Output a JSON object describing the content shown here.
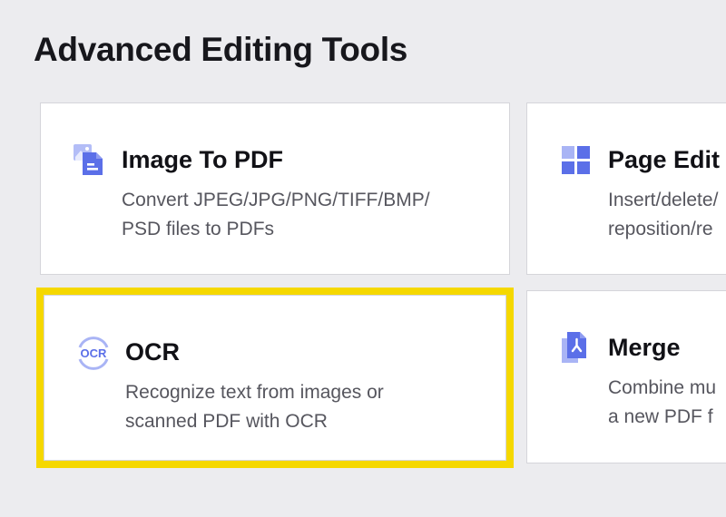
{
  "section": {
    "title": "Advanced Editing Tools"
  },
  "tools": [
    {
      "title": "Image To PDF",
      "desc_lines": [
        "Convert JPEG/JPG/PNG/TIFF/BMP/",
        "PSD files to PDFs"
      ],
      "icon": "image-to-pdf-icon",
      "highlighted": false
    },
    {
      "title": "Page Edit",
      "desc_lines": [
        "Insert/delete/",
        "reposition/re"
      ],
      "icon": "page-edit-icon",
      "highlighted": false
    },
    {
      "title": "OCR",
      "desc_lines": [
        "Recognize text from images or",
        "scanned PDF with OCR"
      ],
      "icon": "ocr-icon",
      "icon_text": "OCR",
      "highlighted": true
    },
    {
      "title": "Merge",
      "desc_lines": [
        "Combine mu",
        "a new PDF f"
      ],
      "icon": "merge-icon",
      "highlighted": false
    }
  ],
  "colors": {
    "background": "#ececef",
    "card": "#ffffff",
    "highlight": "#f5d800",
    "icon_accent": "#5b6fe8",
    "icon_light": "#a9b4f5"
  }
}
